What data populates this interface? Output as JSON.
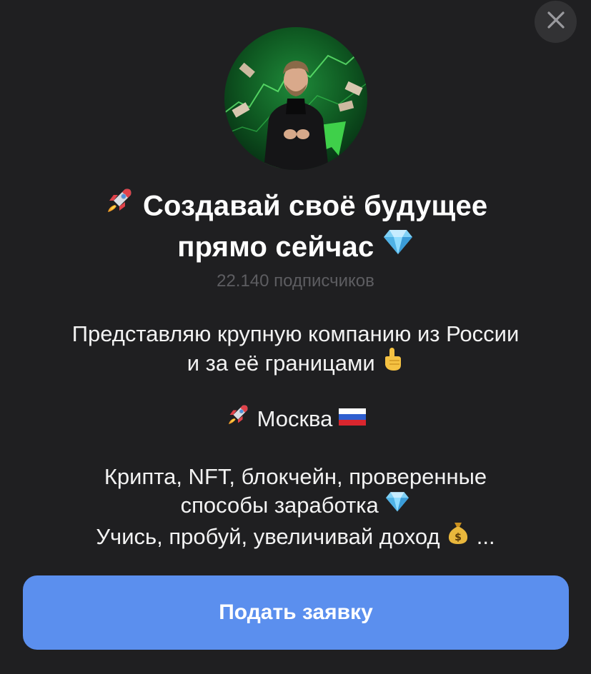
{
  "channel": {
    "title_line1": "Создавай своё будущее",
    "title_line2": "прямо сейчас",
    "subscribers": "22.140 подписчиков"
  },
  "description": {
    "line1": "Представляю крупную компанию из России",
    "line2": "и за её границами",
    "line3": "Москва",
    "line4": "Крипта, NFT, блокчейн, проверенные",
    "line5": "способы заработка",
    "line6": "Учись, пробуй, увеличивай доход",
    "ellipsis": "..."
  },
  "actions": {
    "apply_label": "Подать заявку"
  },
  "icons": {
    "close": "close-icon",
    "rocket": "rocket-icon",
    "diamond": "diamond-icon",
    "pointing_up": "pointing-up-icon",
    "flag": "russia-flag-icon",
    "money_bag": "money-bag-icon"
  },
  "colors": {
    "background": "#1f1f21",
    "accent_button": "#5b8fee",
    "muted_text": "#5d5d61",
    "close_bg": "#323234"
  }
}
